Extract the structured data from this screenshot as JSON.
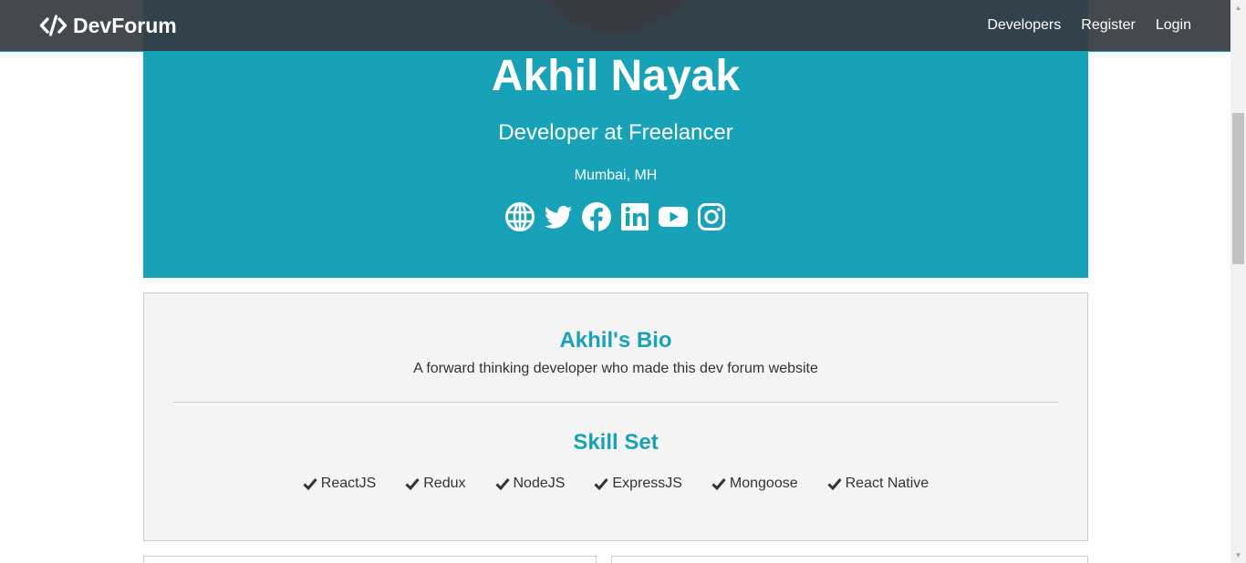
{
  "navbar": {
    "brand": "DevForum",
    "links": [
      "Developers",
      "Register",
      "Login"
    ]
  },
  "profile": {
    "name": "Akhil Nayak",
    "title": "Developer at Freelancer",
    "location": "Mumbai, MH",
    "socials": [
      "globe-icon",
      "twitter-icon",
      "facebook-icon",
      "linkedin-icon",
      "youtube-icon",
      "instagram-icon"
    ]
  },
  "about": {
    "bio_title": "Akhil's Bio",
    "bio_text": "A forward thinking developer who made this dev forum website",
    "skills_title": "Skill Set",
    "skills": [
      "ReactJS",
      "Redux",
      "NodeJS",
      "ExpressJS",
      "Mongoose",
      "React Native"
    ]
  },
  "colors": {
    "accent": "#17a2b8",
    "navbar": "#343a40",
    "about_bg": "#f4f4f4"
  }
}
